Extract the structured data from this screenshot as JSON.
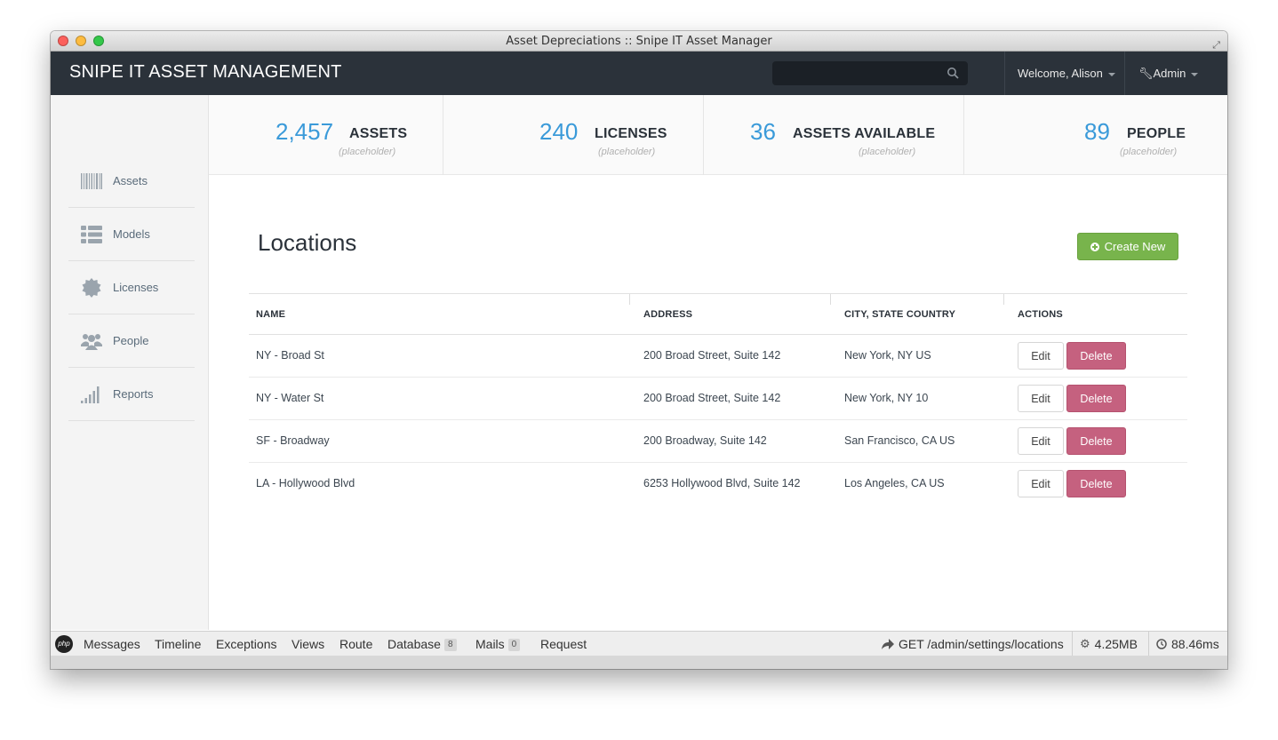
{
  "window": {
    "title": "Asset Depreciations :: Snipe IT Asset Manager"
  },
  "navbar": {
    "brand": "SNIPE IT ASSET MANAGEMENT",
    "search_placeholder": "",
    "welcome": "Welcome, Alison",
    "admin": "Admin"
  },
  "sidebar": {
    "items": [
      {
        "label": "Assets",
        "icon": "barcode-icon"
      },
      {
        "label": "Models",
        "icon": "list-icon"
      },
      {
        "label": "Licenses",
        "icon": "certificate-icon"
      },
      {
        "label": "People",
        "icon": "group-icon"
      },
      {
        "label": "Reports",
        "icon": "signal-icon"
      }
    ]
  },
  "stats": [
    {
      "value": "2,457",
      "label": "ASSETS",
      "sub": "(placeholder)"
    },
    {
      "value": "240",
      "label": "LICENSES",
      "sub": "(placeholder)"
    },
    {
      "value": "36",
      "label": "ASSETS AVAILABLE",
      "sub": "(placeholder)"
    },
    {
      "value": "89",
      "label": "PEOPLE",
      "sub": "(placeholder)"
    }
  ],
  "main": {
    "title": "Locations",
    "create_label": "Create New",
    "columns": [
      "NAME",
      "ADDRESS",
      "CITY, STATE COUNTRY",
      "ACTIONS"
    ],
    "rows": [
      {
        "name": "NY - Broad St",
        "address": "200 Broad Street, Suite 142",
        "city": "New York, NY US"
      },
      {
        "name": "NY - Water St",
        "address": "200 Broad Street, Suite 142",
        "city": "New York, NY 10"
      },
      {
        "name": "SF - Broadway",
        "address": "200 Broadway, Suite 142",
        "city": "San Francisco, CA US"
      },
      {
        "name": "LA - Hollywood Blvd",
        "address": "6253 Hollywood Blvd, Suite 142",
        "city": "Los Angeles, CA US"
      }
    ],
    "edit_label": "Edit",
    "delete_label": "Delete"
  },
  "debugbar": {
    "logo": "php",
    "tabs": [
      "Messages",
      "Timeline",
      "Exceptions",
      "Views",
      "Route",
      "Database",
      "Mails",
      "Request"
    ],
    "database_count": "8",
    "mails_count": "0",
    "route": "GET /admin/settings/locations",
    "memory": "4.25MB",
    "time": "88.46ms"
  },
  "colors": {
    "navbar": "#2b323a",
    "accent_blue": "#3a9ad9",
    "create_green": "#78b44c",
    "delete_pink": "#c5617f"
  }
}
